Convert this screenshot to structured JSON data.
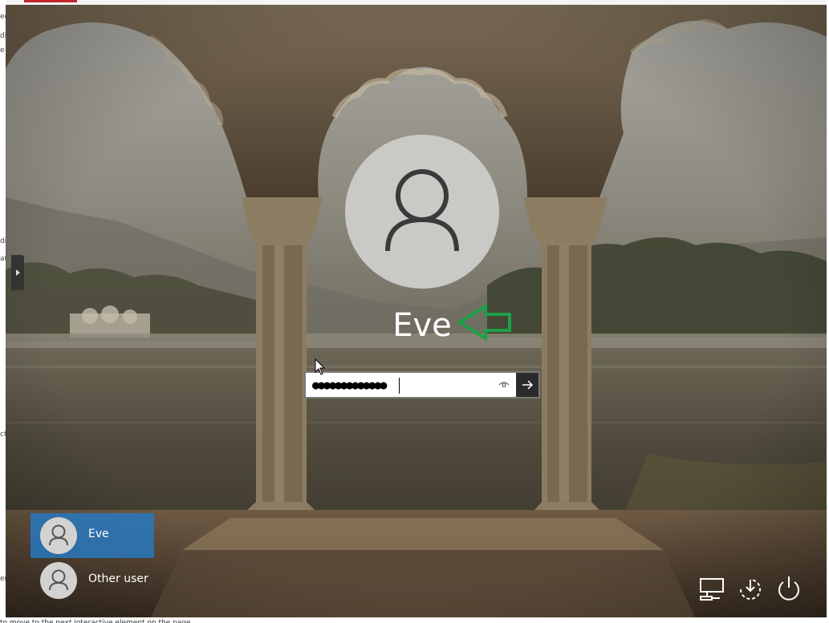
{
  "background": {
    "sky": "#8f8c84",
    "water": "#4a4436",
    "accent_selected": "#2878be"
  },
  "underlying_window": {
    "left_fragments": [
      "ed",
      "di",
      "e",
      "di",
      "at",
      "ct",
      "er"
    ],
    "bottom_text": "to move to the next interactive element on the page"
  },
  "lock_screen": {
    "side_tab_icon": "chevron-right-icon",
    "avatar_icon": "user-icon",
    "username": "Eve",
    "annotation_arrow_icon": "green-arrow-left-icon",
    "password": {
      "value": "●●●●●●●●●●●●●",
      "reveal_icon": "eye-icon",
      "submit_icon": "arrow-right-icon"
    },
    "users": [
      {
        "label": "Eve",
        "selected": true,
        "icon": "user-icon"
      },
      {
        "label": "Other user",
        "selected": false,
        "icon": "user-icon"
      }
    ],
    "tray": {
      "network_icon": "network-icon",
      "accessibility_icon": "ease-of-access-icon",
      "power_icon": "power-icon"
    }
  }
}
